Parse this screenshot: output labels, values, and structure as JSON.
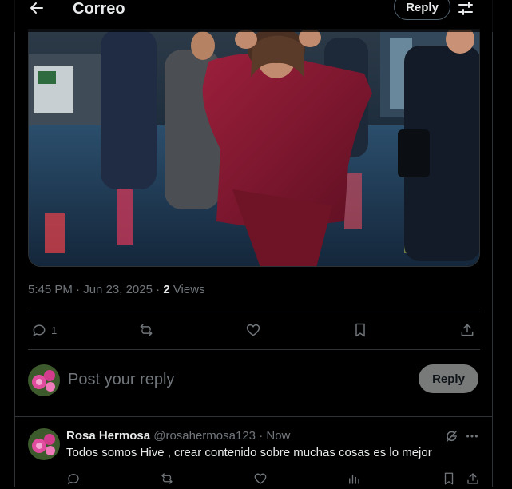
{
  "header": {
    "title": "Correo",
    "reply_label": "Reply"
  },
  "post": {
    "time": "5:45 PM",
    "separator": "·",
    "date": "Jun 23, 2025",
    "views_count": "2",
    "views_label": "Views",
    "stats": {
      "replies": "1"
    }
  },
  "compose": {
    "placeholder": "Post your reply",
    "reply_label": "Reply"
  },
  "reply_tweet": {
    "name": "Rosa Hermosa",
    "handle": "@rosahermosa123",
    "dot": "·",
    "time": "Now",
    "text": "Todos somos Hive , crear contenido sobre muchas cosas es lo mejor"
  },
  "icons": {
    "back": "arrow-left-icon",
    "settings": "sliders-icon",
    "reply": "speech-bubble-icon",
    "repost": "repost-icon",
    "like": "heart-icon",
    "bookmark": "bookmark-icon",
    "share": "share-icon",
    "views": "bar-chart-icon",
    "grok": "grok-icon",
    "more": "more-dots-icon"
  },
  "colors": {
    "accent_text": "#e7e9ea",
    "muted": "#71767b",
    "border": "#2f3336",
    "reply_button": "#787a7a"
  }
}
